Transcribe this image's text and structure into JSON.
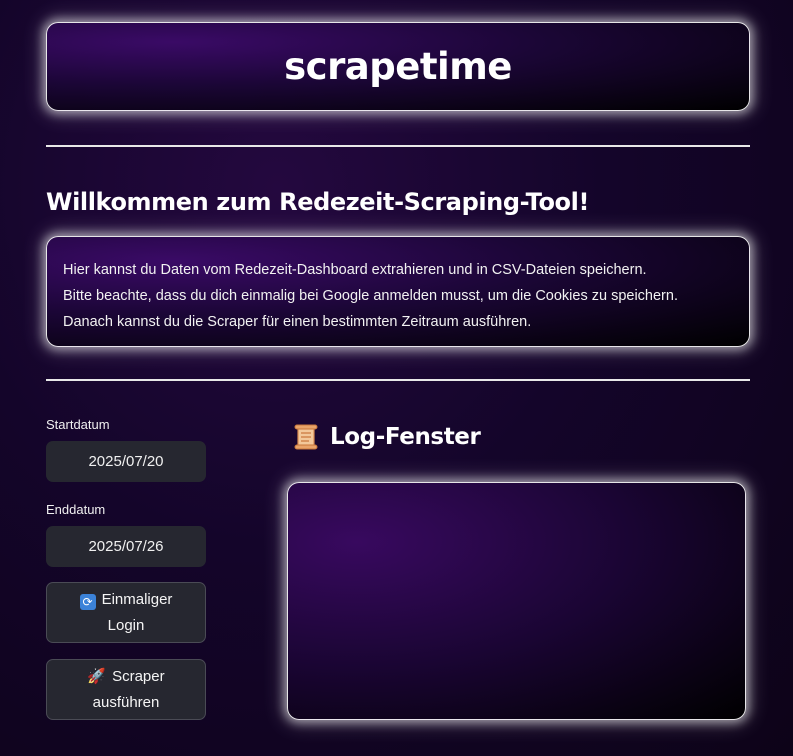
{
  "app": {
    "title": "scrapetime"
  },
  "welcome": {
    "heading": "Willkommen zum Redezeit-Scraping-Tool!",
    "lines": [
      "Hier kannst du Daten vom Redezeit-Dashboard extrahieren und in CSV-Dateien speichern.",
      "Bitte beachte, dass du dich einmalig bei Google anmelden musst, um die Cookies zu speichern.",
      "Danach kannst du die Scraper für einen bestimmten Zeitraum ausführen."
    ]
  },
  "form": {
    "start_label": "Startdatum",
    "start_value": "2025/07/20",
    "end_label": "Enddatum",
    "end_value": "2025/07/26"
  },
  "buttons": {
    "login_icon": "refresh-icon",
    "login_line1": "Einmaliger",
    "login_line2": "Login",
    "scraper_icon": "rocket-icon",
    "scraper_line1": "Scraper",
    "scraper_line2": "ausführen"
  },
  "log": {
    "icon": "scroll-icon",
    "title": "Log-Fenster"
  }
}
